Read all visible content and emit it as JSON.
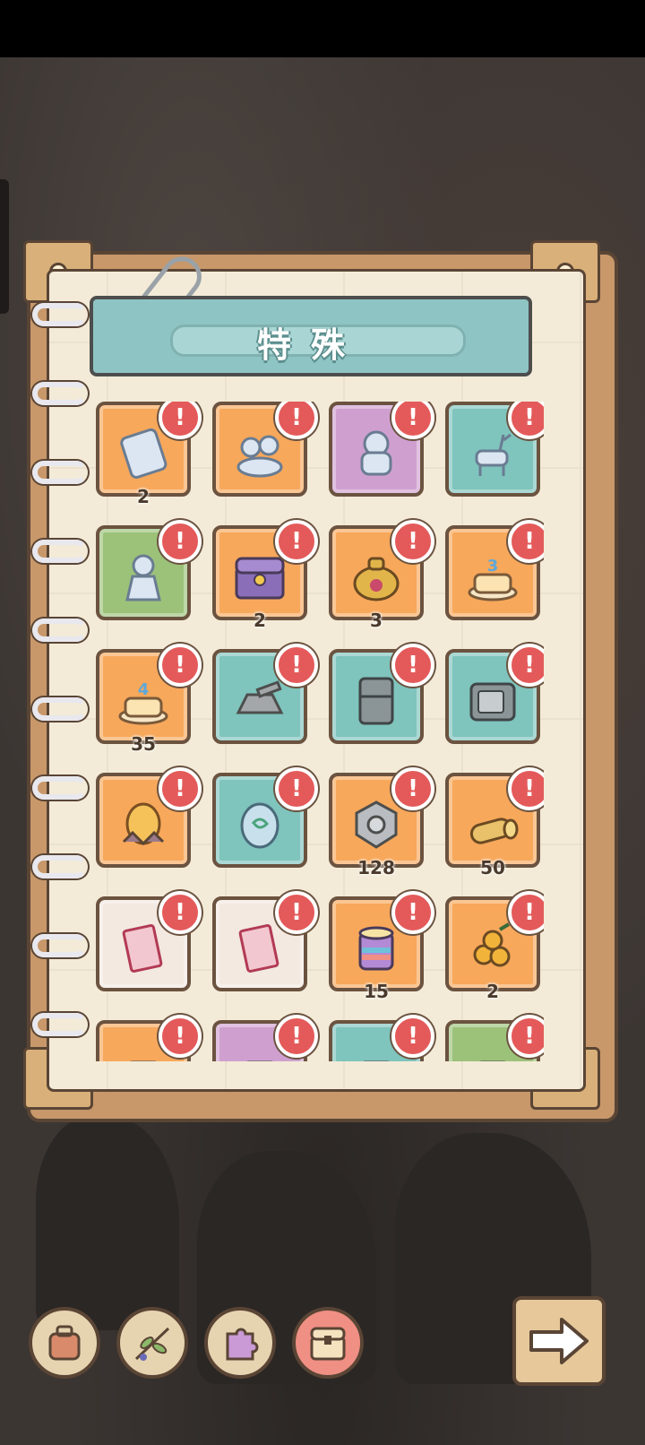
{
  "header": {
    "title": "特殊"
  },
  "badge_symbol": "!",
  "colors": {
    "orange": "#f7a85b",
    "teal": "#7fc4bd",
    "purple": "#cfa0cf",
    "green": "#9cc27a",
    "cream": "#f3e9e1",
    "badge": "#e45a5a"
  },
  "items": [
    {
      "name": "ice-tag-item",
      "bg": "orange",
      "count": "2",
      "alert": true,
      "icon": "ice-tag-icon"
    },
    {
      "name": "ice-mushroom-item",
      "bg": "orange",
      "count": "",
      "alert": true,
      "icon": "ice-mushroom-icon"
    },
    {
      "name": "ice-statue-item",
      "bg": "purple",
      "count": "",
      "alert": true,
      "icon": "ice-statue-icon"
    },
    {
      "name": "ice-deer-item",
      "bg": "teal",
      "count": "",
      "alert": true,
      "icon": "ice-deer-icon"
    },
    {
      "name": "ice-goblin-item",
      "bg": "green",
      "count": "",
      "alert": true,
      "icon": "ice-goblin-icon"
    },
    {
      "name": "treasure-chest-item",
      "bg": "orange",
      "count": "2",
      "alert": true,
      "icon": "treasure-chest-icon"
    },
    {
      "name": "money-bag-item",
      "bg": "orange",
      "count": "3",
      "alert": true,
      "icon": "money-bag-icon"
    },
    {
      "name": "birthday-cake-3-item",
      "bg": "orange",
      "count": "",
      "alert": true,
      "icon": "cake-3-icon"
    },
    {
      "name": "birthday-cake-4-item",
      "bg": "orange",
      "count": "35",
      "alert": true,
      "icon": "cake-4-icon"
    },
    {
      "name": "stone-tank-item",
      "bg": "teal",
      "count": "",
      "alert": true,
      "icon": "tank-icon"
    },
    {
      "name": "fridge-item",
      "bg": "teal",
      "count": "",
      "alert": true,
      "icon": "fridge-icon"
    },
    {
      "name": "old-tv-item",
      "bg": "teal",
      "count": "",
      "alert": true,
      "icon": "tv-icon"
    },
    {
      "name": "golden-egg-item",
      "bg": "orange",
      "count": "",
      "alert": true,
      "icon": "golden-egg-icon"
    },
    {
      "name": "blue-egg-item",
      "bg": "teal",
      "count": "",
      "alert": true,
      "icon": "blue-egg-icon"
    },
    {
      "name": "stone-gear-item",
      "bg": "orange",
      "count": "128",
      "alert": true,
      "icon": "stone-gear-icon"
    },
    {
      "name": "wood-log-item",
      "bg": "orange",
      "count": "50",
      "alert": true,
      "icon": "log-icon"
    },
    {
      "name": "ticket-34-item",
      "bg": "cream",
      "count": "",
      "alert": true,
      "icon": "ticket-icon"
    },
    {
      "name": "ticket-14-item",
      "bg": "cream",
      "count": "",
      "alert": true,
      "icon": "ticket-icon"
    },
    {
      "name": "rainbow-drum-item",
      "bg": "orange",
      "count": "15",
      "alert": true,
      "icon": "drum-icon"
    },
    {
      "name": "golden-fruit-item",
      "bg": "orange",
      "count": "2",
      "alert": true,
      "icon": "fruit-icon"
    },
    {
      "name": "partial-item-1",
      "bg": "orange",
      "count": "",
      "alert": true,
      "icon": "unknown-icon"
    },
    {
      "name": "partial-item-2",
      "bg": "purple",
      "count": "",
      "alert": true,
      "icon": "unknown-icon"
    },
    {
      "name": "partial-item-3",
      "bg": "teal",
      "count": "",
      "alert": true,
      "icon": "unknown-icon"
    },
    {
      "name": "partial-item-4",
      "bg": "green",
      "count": "",
      "alert": true,
      "icon": "unknown-icon"
    }
  ],
  "bottom_nav": [
    {
      "name": "backpack-tab",
      "icon": "backpack-icon",
      "active": false
    },
    {
      "name": "plant-tab",
      "icon": "leaf-branch-icon",
      "active": false
    },
    {
      "name": "puzzle-tab",
      "icon": "puzzle-icon",
      "active": false
    },
    {
      "name": "special-tab",
      "icon": "chest-icon",
      "active": true
    }
  ],
  "next_button": {
    "icon": "arrow-right-icon"
  }
}
